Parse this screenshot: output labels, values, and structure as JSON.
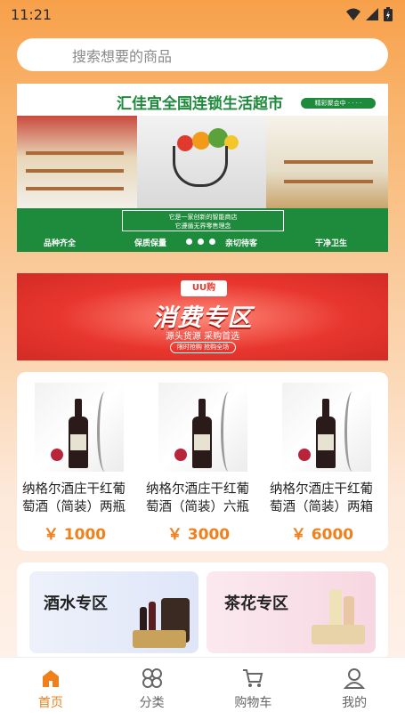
{
  "status": {
    "time": "11:21"
  },
  "search": {
    "placeholder": "搜索想要的商品"
  },
  "banner": {
    "title": "汇佳宜全国连锁生活超市",
    "tag": "精彩聚会中 · · · ·",
    "box_line1": "它是一家创新的智能商店",
    "box_line2": "它遵循无界零售理念",
    "foot_left": "品种齐全",
    "foot_mid": "保质保量",
    "foot_mid2": "亲切待客",
    "foot_right": "干净卫生"
  },
  "promo": {
    "badge": "UU购",
    "title": "消费专区",
    "subtitle": "源头货源 采购首选",
    "pill": "限时抢购 抢购全场"
  },
  "products": [
    {
      "name_line1": "纳格尔酒庄干红葡",
      "name_line2": "萄酒（简装）两瓶",
      "price": "￥ 1000"
    },
    {
      "name_line1": "纳格尔酒庄干红葡",
      "name_line2": "萄酒（简装）六瓶",
      "price": "￥ 3000"
    },
    {
      "name_line1": "纳格尔酒庄干红葡",
      "name_line2": "萄酒（简装）两箱",
      "price": "￥ 6000"
    }
  ],
  "zones": [
    {
      "label": "酒水专区"
    },
    {
      "label": "茶花专区"
    }
  ],
  "tabs": [
    {
      "label": "首页",
      "icon": "home-icon",
      "active": true
    },
    {
      "label": "分类",
      "icon": "category-icon",
      "active": false
    },
    {
      "label": "购物车",
      "icon": "cart-icon",
      "active": false
    },
    {
      "label": "我的",
      "icon": "profile-icon",
      "active": false
    }
  ],
  "colors": {
    "accent": "#f0801c",
    "banner_green": "#1e8a3c",
    "promo_red": "#e8362e"
  }
}
